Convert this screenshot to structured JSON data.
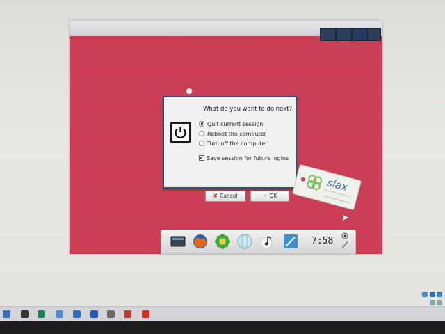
{
  "dialog": {
    "prompt": "What do you want to do next?",
    "options": [
      {
        "label": "Quit current session",
        "selected": true
      },
      {
        "label": "Reboot the computer",
        "selected": false
      },
      {
        "label": "Turn off the computer",
        "selected": false
      }
    ],
    "save_session": {
      "label": "Save session for future logins",
      "checked": true
    },
    "cancel_label": "Cancel",
    "ok_label": "OK"
  },
  "slax_tag": {
    "brand": "slax"
  },
  "dock": {
    "clock": "7:58",
    "items": [
      "terminal-icon",
      "firefox-icon",
      "icq-icon",
      "network-icon",
      "music-icon",
      "editor-icon"
    ]
  },
  "colors": {
    "desktop_red": "#cc3f56",
    "dialog_border": "#34507a",
    "workspace": "#2c3e5a"
  }
}
